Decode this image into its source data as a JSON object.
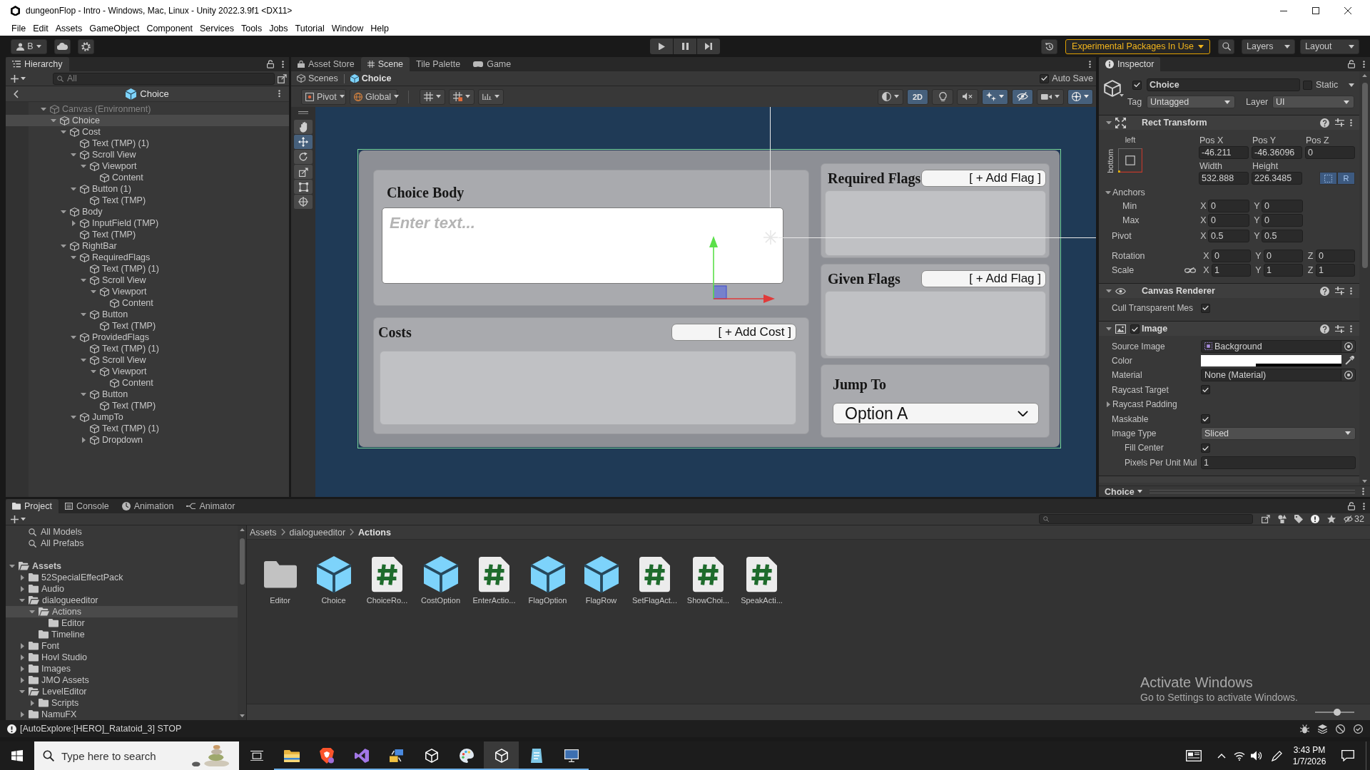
{
  "window": {
    "title": "dungeonFlop - Intro - Windows, Mac, Linux - Unity 2022.3.9f1 <DX11>"
  },
  "menu": [
    "File",
    "Edit",
    "Assets",
    "GameObject",
    "Component",
    "Services",
    "Tools",
    "Jobs",
    "Tutorial",
    "Window",
    "Help"
  ],
  "toolbar": {
    "account": "B",
    "experimental_notice": "Experimental Packages In Use",
    "layers": "Layers",
    "layout": "Layout"
  },
  "hierarchy": {
    "tab": "Hierarchy",
    "search": {
      "placeholder": "All"
    },
    "prefab_title": "Choice",
    "tree": [
      {
        "label": "Canvas (Environment)",
        "expanded": true,
        "selected": false,
        "disabled": true,
        "children": [
          {
            "label": "Choice",
            "expanded": true,
            "selected": true,
            "children": [
              {
                "label": "Cost",
                "expanded": true,
                "selected": false,
                "children": [
                  {
                    "label": "Text (TMP) (1)",
                    "selected": false
                  },
                  {
                    "label": "Scroll View",
                    "expanded": true,
                    "selected": false,
                    "children": [
                      {
                        "label": "Viewport",
                        "expanded": true,
                        "selected": false,
                        "children": [
                          {
                            "label": "Content",
                            "selected": false
                          }
                        ]
                      }
                    ]
                  },
                  {
                    "label": "Button (1)",
                    "expanded": true,
                    "selected": false,
                    "children": [
                      {
                        "label": "Text (TMP)",
                        "selected": false
                      }
                    ]
                  }
                ]
              },
              {
                "label": "Body",
                "expanded": true,
                "selected": false,
                "children": [
                  {
                    "label": "InputField (TMP)",
                    "expanded": false,
                    "selected": false
                  },
                  {
                    "label": "Text (TMP)",
                    "selected": false
                  }
                ]
              },
              {
                "label": "RightBar",
                "expanded": true,
                "selected": false,
                "children": [
                  {
                    "label": "RequiredFlags",
                    "expanded": true,
                    "selected": false,
                    "children": [
                      {
                        "label": "Text (TMP) (1)",
                        "selected": false
                      },
                      {
                        "label": "Scroll View",
                        "expanded": true,
                        "selected": false,
                        "children": [
                          {
                            "label": "Viewport",
                            "expanded": true,
                            "selected": false,
                            "children": [
                              {
                                "label": "Content",
                                "selected": false
                              }
                            ]
                          }
                        ]
                      },
                      {
                        "label": "Button",
                        "expanded": true,
                        "selected": false,
                        "children": [
                          {
                            "label": "Text (TMP)",
                            "selected": false
                          }
                        ]
                      }
                    ]
                  },
                  {
                    "label": "ProvidedFlags",
                    "expanded": true,
                    "selected": false,
                    "children": [
                      {
                        "label": "Text (TMP) (1)",
                        "selected": false
                      },
                      {
                        "label": "Scroll View",
                        "expanded": true,
                        "selected": false,
                        "children": [
                          {
                            "label": "Viewport",
                            "expanded": true,
                            "selected": false,
                            "children": [
                              {
                                "label": "Content",
                                "selected": false
                              }
                            ]
                          }
                        ]
                      },
                      {
                        "label": "Button",
                        "expanded": true,
                        "selected": false,
                        "children": [
                          {
                            "label": "Text (TMP)",
                            "selected": false
                          }
                        ]
                      }
                    ]
                  },
                  {
                    "label": "JumpTo",
                    "expanded": true,
                    "selected": false,
                    "children": [
                      {
                        "label": "Text (TMP) (1)",
                        "selected": false
                      },
                      {
                        "label": "Dropdown",
                        "expanded": false,
                        "selected": false
                      }
                    ]
                  }
                ]
              }
            ]
          }
        ]
      }
    ]
  },
  "scene_tabs": [
    {
      "label": "Asset Store",
      "kind": "store",
      "selected": false
    },
    {
      "label": "Scene",
      "kind": "scene",
      "selected": true
    },
    {
      "label": "Tile Palette",
      "kind": "palette",
      "selected": false
    },
    {
      "label": "Game",
      "kind": "game",
      "selected": false
    }
  ],
  "scene": {
    "breadcrumb": [
      {
        "label": "Scenes",
        "kind": "scenes"
      },
      {
        "label": "Choice",
        "kind": "prefab"
      }
    ],
    "auto_save": {
      "label": "Auto Save",
      "checked": true
    },
    "handle_position": "Pivot",
    "handle_space": "Global",
    "view_toggles": [
      {
        "kind": "flat",
        "label": "2D",
        "on": true
      },
      {
        "kind": "lighting",
        "on": false
      },
      {
        "kind": "audio",
        "on": false
      },
      {
        "kind": "effects",
        "on": true
      },
      {
        "kind": "visibility",
        "on": true
      },
      {
        "kind": "camera",
        "on": false
      },
      {
        "kind": "gizmos",
        "on": true
      }
    ],
    "tools": [
      {
        "kind": "hand",
        "selected": false
      },
      {
        "kind": "move",
        "selected": true
      },
      {
        "kind": "rotate",
        "selected": false
      },
      {
        "kind": "scale",
        "selected": false
      },
      {
        "kind": "rect",
        "selected": false
      },
      {
        "kind": "transform",
        "selected": false
      }
    ],
    "prefab": {
      "body": {
        "title": "Choice Body",
        "placeholder": "Enter text..."
      },
      "costs": {
        "title": "Costs",
        "button": "[ + Add Cost ]"
      },
      "flag_panels": [
        {
          "title": "Required Flags",
          "button": "[ + Add Flag ]"
        },
        {
          "title": "Given Flags",
          "button": "[ + Add Flag ]"
        }
      ],
      "jump_to": {
        "title": "Jump To",
        "value": "Option A"
      }
    }
  },
  "inspector": {
    "tab": "Inspector",
    "object": {
      "active": true,
      "name": "Choice",
      "static_label": "Static",
      "static": false,
      "tag_label": "Tag",
      "tag": "Untagged",
      "layer_label": "Layer",
      "layer": "UI"
    },
    "rect_transform": {
      "title": "Rect Transform",
      "expanded": true,
      "anchor_horizontal": "left",
      "anchor_vertical": "bottom",
      "position_fields": [
        {
          "label": "Pos X",
          "value": "-46.211"
        },
        {
          "label": "Pos Y",
          "value": "-46.36096"
        },
        {
          "label": "Pos Z",
          "value": "0"
        }
      ],
      "size_fields": [
        {
          "label": "Width",
          "value": "532.888"
        },
        {
          "label": "Height",
          "value": "226.3485"
        }
      ],
      "blueprint_mode": {
        "on": true
      },
      "raw_edit": {
        "label": "R",
        "on": true
      },
      "anchors": {
        "label": "Anchors",
        "expanded": true,
        "rows": [
          {
            "label": "Min",
            "values": [
              {
                "axis": "X",
                "value": "0"
              },
              {
                "axis": "Y",
                "value": "0"
              }
            ]
          },
          {
            "label": "Max",
            "values": [
              {
                "axis": "X",
                "value": "0"
              },
              {
                "axis": "Y",
                "value": "0"
              }
            ]
          }
        ]
      },
      "vectors": [
        {
          "label": "Pivot",
          "values": [
            {
              "axis": "X",
              "value": "0.5"
            },
            {
              "axis": "Y",
              "value": "0.5"
            }
          ]
        },
        {
          "label": "Rotation",
          "values": [
            {
              "axis": "X",
              "value": "0"
            },
            {
              "axis": "Y",
              "value": "0"
            },
            {
              "axis": "Z",
              "value": "0"
            }
          ]
        },
        {
          "label": "Scale",
          "constrained": false,
          "values": [
            {
              "axis": "X",
              "value": "1"
            },
            {
              "axis": "Y",
              "value": "1"
            },
            {
              "axis": "Z",
              "value": "1"
            }
          ]
        }
      ]
    },
    "components": [
      {
        "kind": "canvas_renderer",
        "title": "Canvas Renderer",
        "expanded": true,
        "rows": [
          {
            "kind": "checkbox",
            "label": "Cull Transparent Mes",
            "checked": true
          }
        ]
      },
      {
        "kind": "image",
        "title": "Image",
        "enabled": true,
        "expanded": true,
        "rows": [
          {
            "kind": "sprite",
            "label": "Source Image",
            "value": "Background"
          },
          {
            "kind": "color",
            "label": "Color",
            "color": "#ffffff",
            "level": 0.39
          },
          {
            "kind": "object",
            "label": "Material",
            "value": "None (Material)"
          },
          {
            "kind": "checkbox",
            "label": "Raycast Target",
            "checked": true
          },
          {
            "kind": "foldout",
            "label": "Raycast Padding",
            "expanded": false
          },
          {
            "kind": "checkbox",
            "label": "Maskable",
            "checked": true
          },
          {
            "kind": "dropdown",
            "label": "Image Type",
            "value": "Sliced",
            "children": [
              {
                "kind": "checkbox",
                "label": "Fill Center",
                "checked": true
              },
              {
                "kind": "number",
                "label": "Pixels Per Unit Mul",
                "value": "1"
              }
            ]
          }
        ]
      }
    ],
    "footer": "Choice"
  },
  "bottom_tabs": [
    {
      "label": "Project",
      "kind": "project",
      "selected": true
    },
    {
      "label": "Console",
      "kind": "console",
      "selected": false
    },
    {
      "label": "Animation",
      "kind": "animation",
      "selected": false
    },
    {
      "label": "Animator",
      "kind": "animator",
      "selected": false
    }
  ],
  "project": {
    "hidden_packages": "32",
    "favorites": [
      {
        "label": "All Models",
        "selected": false
      },
      {
        "label": "All Prefabs",
        "selected": false
      }
    ],
    "tree": [
      {
        "label": "Assets",
        "expanded": true,
        "selected": false,
        "children": [
          {
            "label": "52SpecialEffectPack",
            "expanded": false,
            "selected": false
          },
          {
            "label": "Audio",
            "expanded": false,
            "selected": false
          },
          {
            "label": "dialogueeditor",
            "expanded": true,
            "selected": false,
            "children": [
              {
                "label": "Actions",
                "expanded": true,
                "selected": true,
                "children": [
                  {
                    "label": "Editor",
                    "selected": false
                  }
                ]
              },
              {
                "label": "Timeline",
                "selected": false
              }
            ]
          },
          {
            "label": "Font",
            "expanded": false,
            "selected": false
          },
          {
            "label": "Hovl Studio",
            "expanded": false,
            "selected": false
          },
          {
            "label": "Images",
            "expanded": false,
            "selected": false
          },
          {
            "label": "JMO Assets",
            "expanded": false,
            "selected": false
          },
          {
            "label": "LevelEditor",
            "expanded": true,
            "selected": false,
            "children": [
              {
                "label": "Scripts",
                "expanded": false,
                "selected": false
              }
            ]
          },
          {
            "label": "NamuFX",
            "expanded": false,
            "selected": false
          }
        ]
      }
    ],
    "breadcrumb": [
      "Assets",
      "dialogueeditor",
      "Actions"
    ],
    "assets": [
      {
        "name": "Editor",
        "kind": "folder"
      },
      {
        "name": "Choice",
        "kind": "prefab"
      },
      {
        "name": "ChoiceRo...",
        "kind": "script"
      },
      {
        "name": "CostOption",
        "kind": "prefab"
      },
      {
        "name": "EnterActio...",
        "kind": "script"
      },
      {
        "name": "FlagOption",
        "kind": "prefab"
      },
      {
        "name": "FlagRow",
        "kind": "prefab"
      },
      {
        "name": "SetFlagAct...",
        "kind": "script"
      },
      {
        "name": "ShowChoi...",
        "kind": "script"
      },
      {
        "name": "SpeakActi...",
        "kind": "script"
      }
    ],
    "icon_size": {
      "level": 0.56
    }
  },
  "status_bar": {
    "message": "[AutoExplore:[HERO]_Ratatoid_3] STOP"
  },
  "activation_notice": {
    "title": "Activate Windows",
    "text": "Go to Settings to activate Windows."
  },
  "taskbar": {
    "search": {
      "placeholder": "Type here to search"
    },
    "apps": [
      {
        "kind": "folder",
        "active": false
      },
      {
        "kind": "shield",
        "active": false
      },
      {
        "kind": "ribbon",
        "active": false
      },
      {
        "kind": "network",
        "active": false
      },
      {
        "kind": "cube",
        "active": false
      },
      {
        "kind": "palette",
        "active": false
      },
      {
        "kind": "cube",
        "active": true
      },
      {
        "kind": "note",
        "active": false
      },
      {
        "kind": "monitor",
        "active": false
      }
    ],
    "time": "3:43 PM",
    "date": "1/7/2026"
  }
}
